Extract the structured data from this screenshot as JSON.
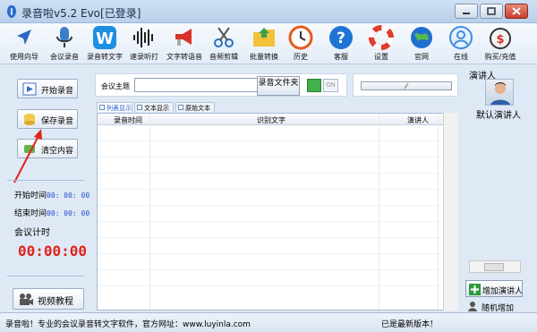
{
  "window": {
    "title": "录音啦v5.2 Evo[已登录]"
  },
  "toolbar": {
    "items": [
      {
        "label": "使用向导",
        "icon": "cursor-arrow-icon"
      },
      {
        "label": "会议录音",
        "icon": "microphone-icon"
      },
      {
        "label": "录音转文字",
        "icon": "w-letter-icon"
      },
      {
        "label": "速录听打",
        "icon": "soundwave-icon"
      },
      {
        "label": "文字转语音",
        "icon": "megaphone-icon"
      },
      {
        "label": "音频剪辑",
        "icon": "scissors-icon"
      },
      {
        "label": "批量转换",
        "icon": "folder-icon"
      },
      {
        "label": "历史",
        "icon": "clock-icon"
      },
      {
        "label": "客服",
        "icon": "help-icon"
      },
      {
        "label": "设置",
        "icon": "lifebuoy-icon"
      },
      {
        "label": "官网",
        "icon": "globe-icon"
      },
      {
        "label": "在线",
        "icon": "user-online-icon"
      },
      {
        "label": "购买/充值",
        "icon": "money-bag-icon"
      }
    ]
  },
  "left": {
    "start_record": "开始录音",
    "save_record": "保存录音",
    "clear": "清空内容",
    "start_time_label": "开始时间",
    "start_time_value": "00: 00: 00",
    "end_time_label": "结束时间",
    "end_time_value": "00: 00: 00",
    "meeting_timer_label": "会议计时",
    "meeting_timer_value": "00:00:00",
    "video_tutorial": "视频教程"
  },
  "main": {
    "topic_label": "会议主题",
    "topic_value": "",
    "export_button": "录音文件夹",
    "toggle_text": "ON",
    "tabs": [
      "列表显示",
      "文本显示",
      "原始文本"
    ],
    "columns": [
      "录音时间",
      "识别文字",
      "演讲人"
    ],
    "rows": []
  },
  "right": {
    "title": "演讲人",
    "default_speaker": "默认演讲人",
    "add_speaker": "增加演讲人",
    "random_speaker": "随机增加"
  },
  "status": {
    "left": "录音啦！专业的会议录音转文字软件，官方网址：www.luyinla.com",
    "right": "已是最新版本！"
  },
  "colors": {
    "timer_red": "#e0241a",
    "time_blue": "#1f4fc7",
    "accent_green": "#40b14a"
  }
}
